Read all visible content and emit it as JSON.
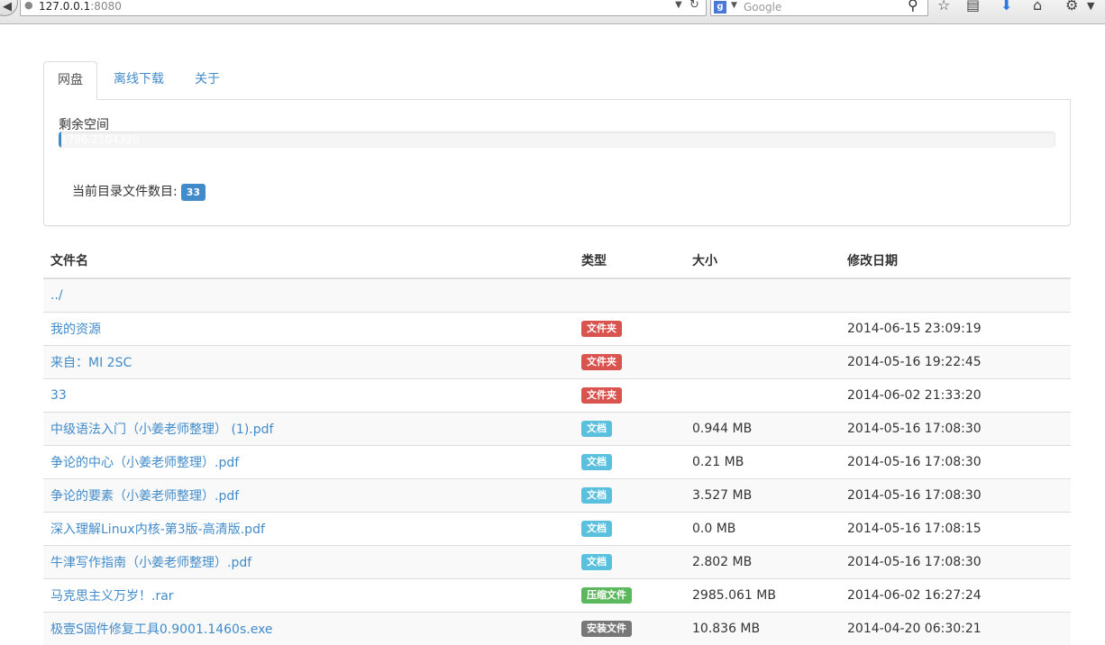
{
  "browser": {
    "url_host": "127.0.0.1",
    "url_port": ":8080",
    "search_placeholder": "Google",
    "search_engine_icon": "g"
  },
  "tabs": [
    {
      "label": "网盘",
      "active": true
    },
    {
      "label": "离线下载",
      "active": false
    },
    {
      "label": "关于",
      "active": false
    }
  ],
  "storage": {
    "label": "剩余空间",
    "progress_text": "1796.2104320",
    "progress_fraction": 0.003,
    "file_count_label": "当前目录文件数目:",
    "file_count": "33"
  },
  "table": {
    "headers": [
      "文件名",
      "类型",
      "大小",
      "修改日期"
    ],
    "rows": [
      {
        "name": "../",
        "type": "",
        "size": "",
        "date": ""
      },
      {
        "name": "我的资源",
        "type": "文件夹",
        "size": "",
        "date": "2014-06-15 23:09:19"
      },
      {
        "name": "来自：MI 2SC",
        "type": "文件夹",
        "size": "",
        "date": "2014-05-16 19:22:45"
      },
      {
        "name": "33",
        "type": "文件夹",
        "size": "",
        "date": "2014-06-02 21:33:20"
      },
      {
        "name": "中级语法入门（小姜老师整理） (1).pdf",
        "type": "文档",
        "size": "0.944 MB",
        "date": "2014-05-16 17:08:30"
      },
      {
        "name": "争论的中心（小姜老师整理）.pdf",
        "type": "文档",
        "size": "0.21 MB",
        "date": "2014-05-16 17:08:30"
      },
      {
        "name": "争论的要素（小姜老师整理）.pdf",
        "type": "文档",
        "size": "3.527 MB",
        "date": "2014-05-16 17:08:30"
      },
      {
        "name": "深入理解Linux内核-第3版-高清版.pdf",
        "type": "文档",
        "size": "0.0 MB",
        "date": "2014-05-16 17:08:15"
      },
      {
        "name": "牛津写作指南（小姜老师整理）.pdf",
        "type": "文档",
        "size": "2.802 MB",
        "date": "2014-05-16 17:08:30"
      },
      {
        "name": "马克思主义万岁！.rar",
        "type": "压缩文件",
        "size": "2985.061 MB",
        "date": "2014-06-02 16:27:24"
      },
      {
        "name": "极壹S固件修复工具0.9001.1460s.exe",
        "type": "安装文件",
        "size": "10.836 MB",
        "date": "2014-04-20 06:30:21"
      }
    ]
  },
  "type_colors": {
    "文件夹": "#d9534f",
    "文档": "#5bc0de",
    "压缩文件": "#5cb85c",
    "安装文件": "#777777"
  },
  "icons": [
    "back-arrow-icon",
    "globe-icon",
    "dropdown-icon",
    "reload-icon",
    "search-icon",
    "star-icon",
    "reading-list-icon",
    "download-icon",
    "home-icon",
    "extension-icon",
    "menu-icon"
  ]
}
